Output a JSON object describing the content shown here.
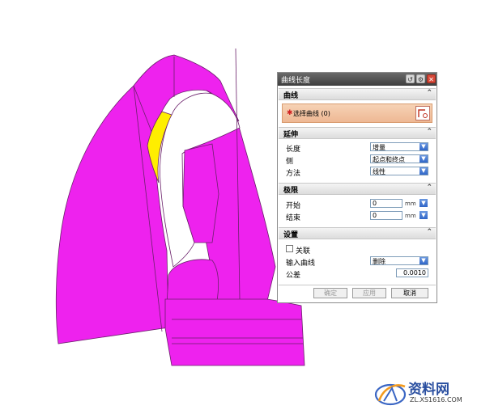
{
  "dialog": {
    "title": "曲线长度",
    "sections": {
      "curve": {
        "header": "曲线",
        "select_label": "选择曲线 (0)"
      },
      "extend": {
        "header": "延伸",
        "length_label": "长度",
        "length_value": "增量",
        "side_label": "侧",
        "side_value": "起点和终点",
        "method_label": "方法",
        "method_value": "线性"
      },
      "limits": {
        "header": "极限",
        "start_label": "开始",
        "start_value": "0",
        "start_unit": "mm",
        "end_label": "结束",
        "end_value": "0",
        "end_unit": "mm"
      },
      "settings": {
        "header": "设置",
        "associative_label": "关联",
        "input_curve_label": "输入曲线",
        "input_curve_value": "删除",
        "tolerance_label": "公差",
        "tolerance_value": "0.0010"
      }
    },
    "buttons": {
      "ok": "确定",
      "apply": "应用",
      "cancel": "取消"
    }
  },
  "watermark": {
    "site_name": "资料网",
    "url": "ZL.XS1616.COM"
  },
  "colors": {
    "model_surface": "#ee22ee",
    "highlight_face": "#ffee00",
    "dialog_accent": "#eeb894"
  }
}
